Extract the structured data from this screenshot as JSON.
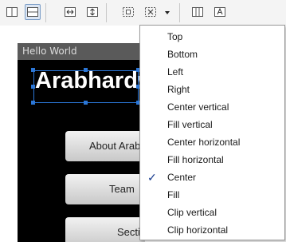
{
  "toolbar": {
    "buttons": [
      {
        "icon": "vertical-layout-icon",
        "active": false
      },
      {
        "icon": "horizontal-layout-icon",
        "active": true
      },
      {
        "icon": "fill-width-icon",
        "active": false
      },
      {
        "icon": "fill-height-icon",
        "active": false
      },
      {
        "icon": "margins-icon",
        "active": false
      },
      {
        "icon": "gravity-icon",
        "active": false
      },
      {
        "icon": "chevron-down-icon",
        "active": false
      },
      {
        "icon": "distribute-columns-icon",
        "active": false
      },
      {
        "icon": "baseline-icon",
        "active": false
      }
    ]
  },
  "device": {
    "window_title": "Hello World",
    "app_title": "Arabhardw",
    "buttons": [
      "About Arab",
      "Team",
      "Secti"
    ]
  },
  "gravity_menu": {
    "items": [
      {
        "label": "Top",
        "checked": false
      },
      {
        "label": "Bottom",
        "checked": false
      },
      {
        "label": "Left",
        "checked": false
      },
      {
        "label": "Right",
        "checked": false
      },
      {
        "label": "Center vertical",
        "checked": false
      },
      {
        "label": "Fill vertical",
        "checked": false
      },
      {
        "label": "Center horizontal",
        "checked": false
      },
      {
        "label": "Fill horizontal",
        "checked": false
      },
      {
        "label": "Center",
        "checked": true
      },
      {
        "label": "Fill",
        "checked": false
      },
      {
        "label": "Clip vertical",
        "checked": false
      },
      {
        "label": "Clip horizontal",
        "checked": false
      }
    ],
    "check_glyph": "✓"
  },
  "colors": {
    "selection": "#2b76d6",
    "device_background": "#000000",
    "titlebar": "#5a5a5a"
  }
}
